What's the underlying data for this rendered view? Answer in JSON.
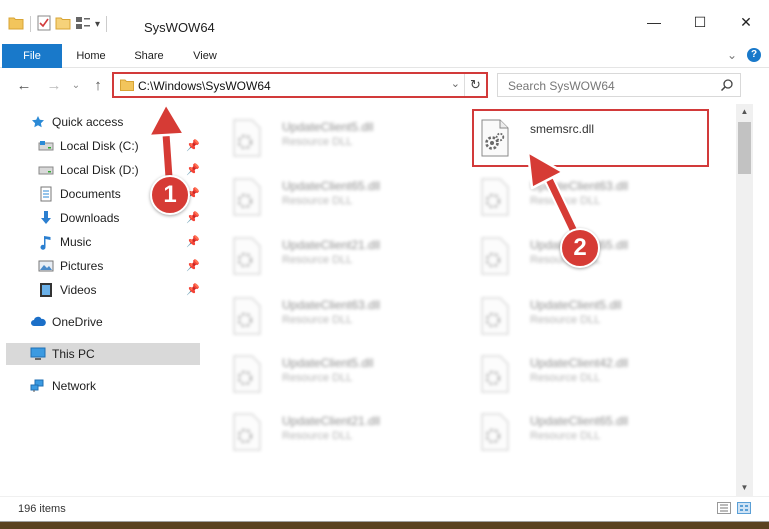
{
  "window": {
    "title": "SysWOW64",
    "controls": {
      "minimize": "—",
      "maximize": "☐",
      "close": "✕"
    }
  },
  "ribbon": {
    "tabs": [
      {
        "label": "File"
      },
      {
        "label": "Home"
      },
      {
        "label": "Share"
      },
      {
        "label": "View"
      }
    ],
    "expand_glyph": "⌄",
    "help_glyph": "?"
  },
  "navigation": {
    "back_glyph": "←",
    "forward_glyph": "→",
    "recent_glyph": "⌄",
    "up_glyph": "↑"
  },
  "address": {
    "path": "C:\\Windows\\SysWOW64",
    "dropdown_glyph": "⌄",
    "refresh_glyph": "↻"
  },
  "search": {
    "placeholder": "Search SysWOW64"
  },
  "sidebar": {
    "quick_access": "Quick access",
    "pinned": [
      {
        "label": "Local Disk (C:)",
        "icon": "drive-icon"
      },
      {
        "label": "Local Disk (D:)",
        "icon": "drive-icon"
      },
      {
        "label": "Documents",
        "icon": "documents-icon"
      },
      {
        "label": "Downloads",
        "icon": "downloads-icon"
      },
      {
        "label": "Music",
        "icon": "music-icon"
      },
      {
        "label": "Pictures",
        "icon": "pictures-icon"
      },
      {
        "label": "Videos",
        "icon": "videos-icon"
      }
    ],
    "onedrive": "OneDrive",
    "this_pc": "This PC",
    "network": "Network"
  },
  "files": {
    "left_column": [
      {
        "name": "UpdateClient5.dll",
        "type": "Resource DLL"
      },
      {
        "name": "UpdateClient65.dll",
        "type": "Resource DLL"
      },
      {
        "name": "UpdateClient21.dll",
        "type": "Resource DLL"
      },
      {
        "name": "UpdateClient63.dll",
        "type": "Resource DLL"
      },
      {
        "name": "UpdateClient5.dll",
        "type": "Resource DLL"
      },
      {
        "name": "UpdateClient21.dll",
        "type": "Resource DLL"
      }
    ],
    "right_column": [
      {
        "name": "smemsrc.dll",
        "type": ""
      },
      {
        "name": "UpdateClient63.dll",
        "type": "Resource DLL"
      },
      {
        "name": "UpdateClient65.dll",
        "type": "Resource DLL"
      },
      {
        "name": "UpdateClient5.dll",
        "type": "Resource DLL"
      },
      {
        "name": "UpdateClient42.dll",
        "type": "Resource DLL"
      },
      {
        "name": "UpdateClient65.dll",
        "type": "Resource DLL"
      }
    ]
  },
  "status": {
    "item_count": "196 items"
  },
  "annotations": {
    "step1": "1",
    "step2": "2",
    "highlight_color": "#d23a3a"
  },
  "colors": {
    "accent": "#1979ca",
    "callout": "#d63b35"
  }
}
